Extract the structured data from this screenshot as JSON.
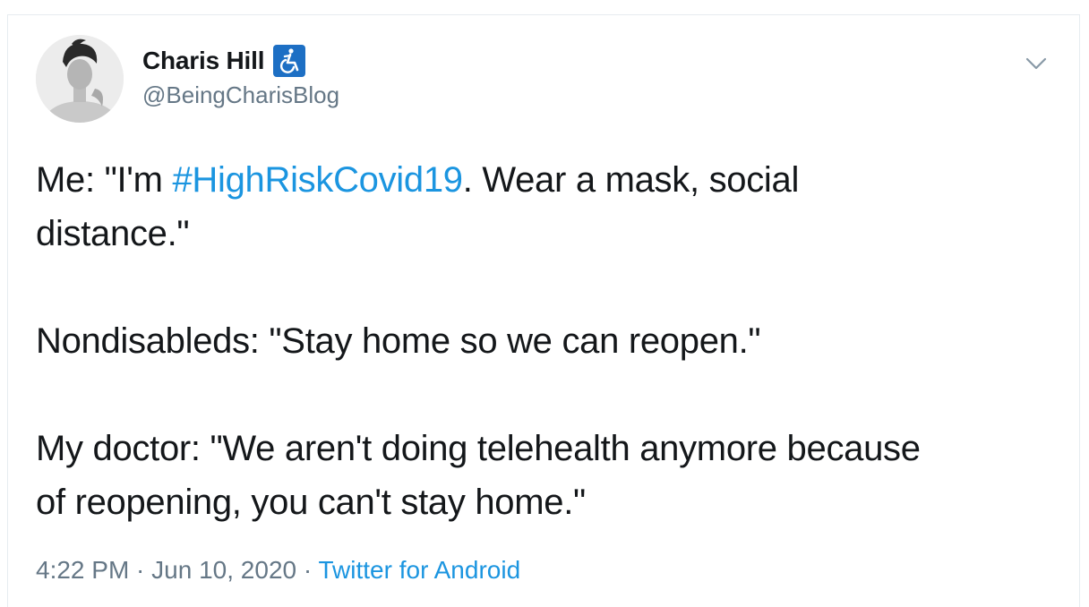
{
  "user": {
    "display_name": "Charis Hill",
    "handle": "@BeingCharisBlog",
    "badge_icon": "wheelchair-icon"
  },
  "tweet": {
    "line1_prefix": "Me: \"I'm ",
    "hashtag": "#HighRiskCovid19",
    "line1_suffix": ". Wear a mask, social",
    "line2": "distance.\"",
    "line3": "Nondisableds: \"Stay home so we can reopen.\"",
    "line4": "My doctor: \"We aren't doing telehealth anymore because",
    "line5": "of reopening, you can't stay home.\""
  },
  "meta": {
    "time": "4:22 PM",
    "separator1": " · ",
    "date": "Jun 10, 2020",
    "separator2": " · ",
    "source": "Twitter for Android"
  },
  "colors": {
    "link": "#1b95e0",
    "secondary_text": "#657786",
    "primary_text": "#14171a",
    "badge": "#1d6fc4"
  }
}
